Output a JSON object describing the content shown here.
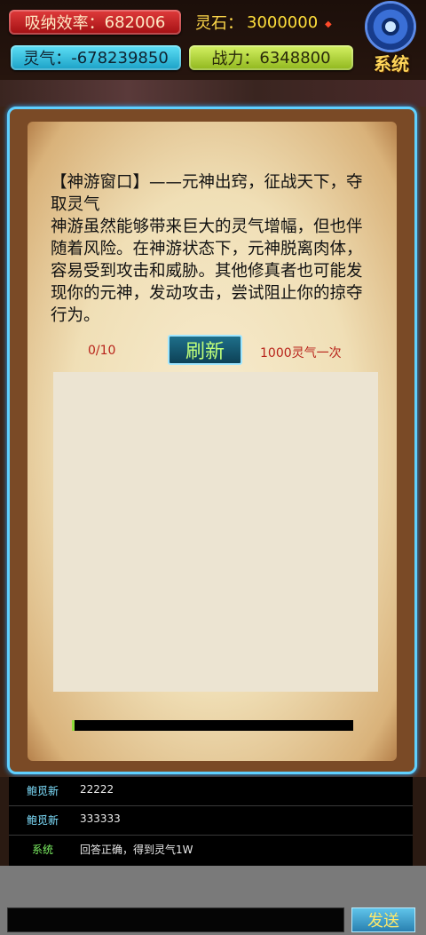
{
  "stats": {
    "absorb_label": "吸纳效率：",
    "absorb_value": "682006",
    "stone_label": "灵石：",
    "stone_value": "3000000",
    "spirit_label": "灵气：",
    "spirit_value": "-678239850",
    "power_label": "战力：",
    "power_value": "6348800"
  },
  "system_button": {
    "label": "系统",
    "icon": "gear-icon"
  },
  "panel": {
    "description": "【神游窗口】——元神出窍，征战天下，夺取灵气\n神游虽然能够带来巨大的灵气增幅，但也伴随着风险。在神游状态下，元神脱离肉体，容易受到攻击和威胁。其他修真者也可能发现你的元神，发动攻击，尝试阻止你的掠夺行为。",
    "count": "0/10",
    "refresh_label": "刷新",
    "cost": "1000灵气一次"
  },
  "chat": {
    "messages": [
      {
        "name": "鲍觅新",
        "text": "22222"
      },
      {
        "name": "鲍觅新",
        "text": "333333"
      },
      {
        "name": "系统",
        "text": "回答正确，得到灵气1W"
      }
    ]
  },
  "input": {
    "send_label": "发送"
  },
  "colors": {
    "accent_blue": "#5fd0ff",
    "absorb_red": "#c8262a",
    "spirit_cyan": "#3cc6e6",
    "power_green": "#b6d83c",
    "count_red": "#b8231a"
  }
}
